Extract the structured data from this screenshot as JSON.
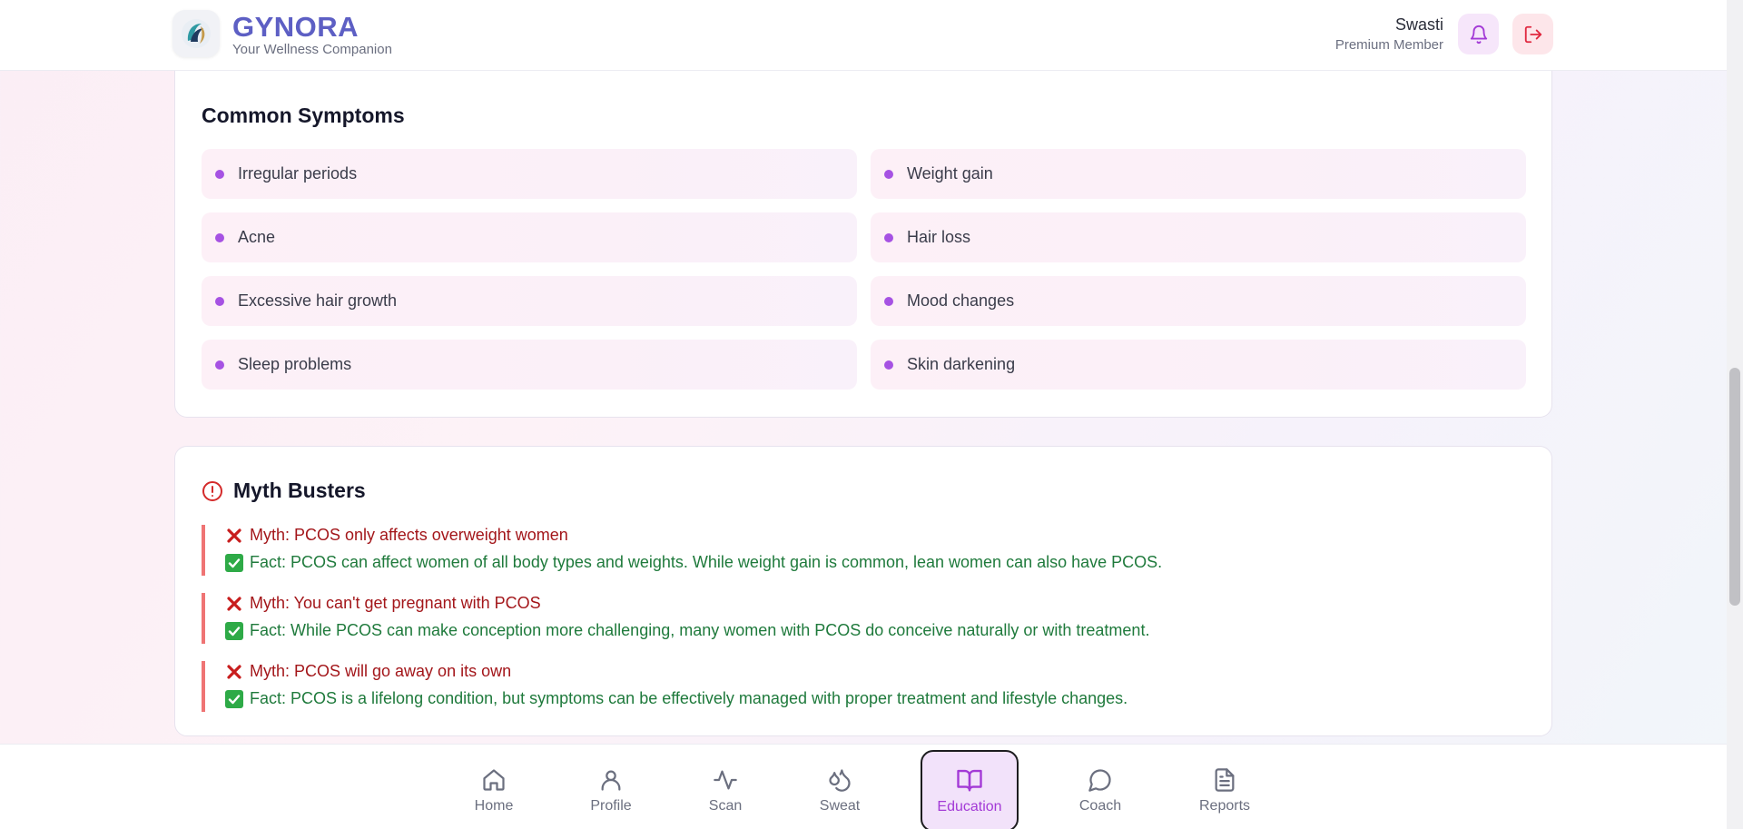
{
  "header": {
    "brand_name": "GYNORA",
    "brand_tagline": "Your Wellness Companion",
    "user_name": "Swasti",
    "user_tier": "Premium Member",
    "bell_icon": "bell-icon",
    "logout_icon": "logout-icon"
  },
  "symptoms": {
    "title": "Common Symptoms",
    "items": [
      "Irregular periods",
      "Weight gain",
      "Acne",
      "Hair loss",
      "Excessive hair growth",
      "Mood changes",
      "Sleep problems",
      "Skin darkening"
    ]
  },
  "myths": {
    "title": "Myth Busters",
    "items": [
      {
        "myth": "Myth: PCOS only affects overweight women",
        "fact": "Fact: PCOS can affect women of all body types and weights. While weight gain is common, lean women can also have PCOS."
      },
      {
        "myth": "Myth: You can't get pregnant with PCOS",
        "fact": "Fact: While PCOS can make conception more challenging, many women with PCOS do conceive naturally or with treatment."
      },
      {
        "myth": "Myth: PCOS will go away on its own",
        "fact": "Fact: PCOS is a lifelong condition, but symptoms can be effectively managed with proper treatment and lifestyle changes."
      }
    ]
  },
  "nav": {
    "items": [
      {
        "label": "Home",
        "icon": "home-icon"
      },
      {
        "label": "Profile",
        "icon": "user-icon"
      },
      {
        "label": "Scan",
        "icon": "activity-icon"
      },
      {
        "label": "Sweat",
        "icon": "droplets-icon"
      },
      {
        "label": "Education",
        "icon": "book-open-icon",
        "active": true
      },
      {
        "label": "Coach",
        "icon": "chat-bubble-icon"
      },
      {
        "label": "Reports",
        "icon": "file-text-icon"
      }
    ]
  },
  "colors": {
    "brand": "#5d5fc4",
    "accent": "#a33ad6",
    "myth": "#a3161a",
    "fact": "#1f7a3c",
    "myth_bar": "#ef7474"
  }
}
